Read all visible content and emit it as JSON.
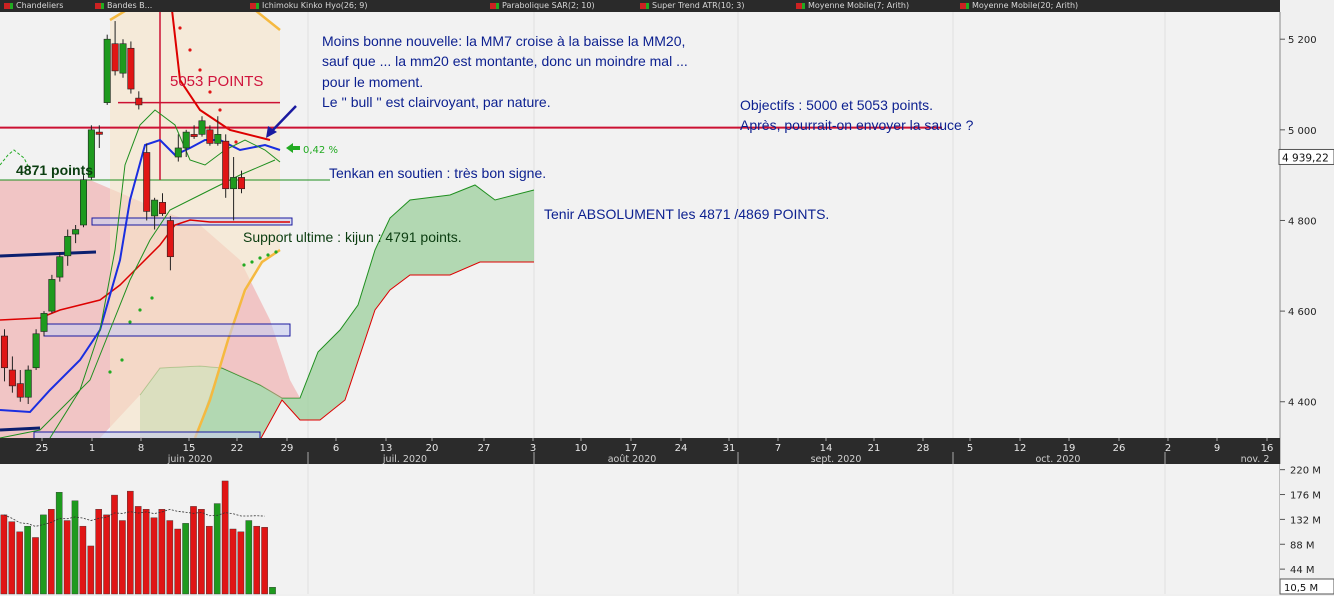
{
  "legend": [
    {
      "label": "Chandeliers"
    },
    {
      "label": "Bandes B..."
    },
    {
      "label": "Ichimoku Kinko Hyo(26; 9)"
    },
    {
      "label": "Parabolique SAR(2; 10)"
    },
    {
      "label": "Super Trend ATR(10; 3)"
    },
    {
      "label": "Moyenne Mobile(7; Arith)"
    },
    {
      "label": "Moyenne Mobile(20; Arith)"
    }
  ],
  "price_axis": {
    "ticks": [
      "5 200",
      "5 000",
      "4 800",
      "4 600",
      "4 400"
    ],
    "current": "4 939,22"
  },
  "volume_axis": {
    "ticks": [
      "220 M",
      "176 M",
      "132 M",
      "88 M",
      "44 M"
    ],
    "current": "10,5 M"
  },
  "time_axis": {
    "days": [
      "25",
      "1",
      "8",
      "15",
      "22",
      "29",
      "6",
      "13",
      "20",
      "27",
      "3",
      "10",
      "17",
      "24",
      "31",
      "7",
      "14",
      "21",
      "28",
      "5",
      "12",
      "19",
      "26",
      "2",
      "9",
      "16"
    ],
    "months": [
      "juin 2020",
      "juil. 2020",
      "août 2020",
      "sept. 2020",
      "oct. 2020",
      "nov. 2"
    ]
  },
  "annotations": {
    "main_lines": [
      "Moins bonne nouvelle: la MM7 croise à la baisse la MM20,",
      "sauf que ... la mm20 est montante, donc un moindre mal ...",
      "pour le moment.",
      "Le '' bull '' est clairvoyant, par nature."
    ],
    "objectifs": [
      "Objectifs : 5000 et 5053 points.",
      "Après, pourrait-on envoyer la sauce ?"
    ],
    "points_5053": "5053 POINTS",
    "points_4871": "4871 points",
    "tenkan": "Tenkan en soutien : très bon signe.",
    "tenir": "Tenir ABSOLUMENT les 4871  /4869 POINTS.",
    "support": "Support ultime : kijun : 4791 points.",
    "pct": "0,42 %"
  },
  "colors": {
    "up": "#1e9a1e",
    "down": "#e01515",
    "tenkan": "#1a2ee0",
    "kijun": "#dd0000",
    "bollinger": "#f5b940",
    "cloud_green": "#9ccf9c",
    "cloud_red": "#f0a0a0",
    "line_red": "#cc1133",
    "navy": "#0b1f6f"
  },
  "chart_data": [
    {
      "type": "candlestick",
      "title": "",
      "ylim": [
        4320,
        5260
      ],
      "xlabel": "",
      "ylabel": "",
      "series": [
        {
          "values": [
            {
              "date": "2020-05-19",
              "o": 4545,
              "h": 4560,
              "l": 4445,
              "c": 4475
            },
            {
              "date": "2020-05-20",
              "o": 4470,
              "h": 4500,
              "l": 4420,
              "c": 4435
            },
            {
              "date": "2020-05-21",
              "o": 4440,
              "h": 4470,
              "l": 4400,
              "c": 4410
            },
            {
              "date": "2020-05-22",
              "o": 4410,
              "h": 4480,
              "l": 4395,
              "c": 4470
            },
            {
              "date": "2020-05-25",
              "o": 4475,
              "h": 4560,
              "l": 4470,
              "c": 4550
            },
            {
              "date": "2020-05-26",
              "o": 4555,
              "h": 4600,
              "l": 4545,
              "c": 4595
            },
            {
              "date": "2020-05-27",
              "o": 4600,
              "h": 4680,
              "l": 4595,
              "c": 4670
            },
            {
              "date": "2020-05-28",
              "o": 4675,
              "h": 4730,
              "l": 4665,
              "c": 4720
            },
            {
              "date": "2020-05-29",
              "o": 4722,
              "h": 4780,
              "l": 4700,
              "c": 4765
            },
            {
              "date": "2020-06-01",
              "o": 4770,
              "h": 4790,
              "l": 4750,
              "c": 4780
            },
            {
              "date": "2020-06-02",
              "o": 4790,
              "h": 4900,
              "l": 4785,
              "c": 4890
            },
            {
              "date": "2020-06-03",
              "o": 4895,
              "h": 5010,
              "l": 4890,
              "c": 5000
            },
            {
              "date": "2020-06-04",
              "o": 4995,
              "h": 5010,
              "l": 4960,
              "c": 4990
            },
            {
              "date": "2020-06-05",
              "o": 5060,
              "h": 5210,
              "l": 5055,
              "c": 5200
            },
            {
              "date": "2020-06-08",
              "o": 5190,
              "h": 5240,
              "l": 5120,
              "c": 5130
            },
            {
              "date": "2020-06-09",
              "o": 5125,
              "h": 5200,
              "l": 5115,
              "c": 5190
            },
            {
              "date": "2020-06-10",
              "o": 5180,
              "h": 5195,
              "l": 5080,
              "c": 5090
            },
            {
              "date": "2020-06-11",
              "o": 5070,
              "h": 5085,
              "l": 5045,
              "c": 5055
            },
            {
              "date": "2020-06-12",
              "o": 4950,
              "h": 4970,
              "l": 4800,
              "c": 4820
            },
            {
              "date": "2020-06-15",
              "o": 4810,
              "h": 4850,
              "l": 4780,
              "c": 4845
            },
            {
              "date": "2020-06-16",
              "o": 4840,
              "h": 4860,
              "l": 4810,
              "c": 4815
            },
            {
              "date": "2020-06-17",
              "o": 4800,
              "h": 4810,
              "l": 4690,
              "c": 4720
            },
            {
              "date": "2020-06-18",
              "o": 4940,
              "h": 4990,
              "l": 4930,
              "c": 4960
            },
            {
              "date": "2020-06-19",
              "o": 4960,
              "h": 5000,
              "l": 4940,
              "c": 4995
            },
            {
              "date": "2020-06-22",
              "o": 4990,
              "h": 5010,
              "l": 4980,
              "c": 4985
            },
            {
              "date": "2020-06-23",
              "o": 4990,
              "h": 5030,
              "l": 4985,
              "c": 5020
            },
            {
              "date": "2020-06-24",
              "o": 5000,
              "h": 5010,
              "l": 4965,
              "c": 4970
            },
            {
              "date": "2020-06-25",
              "o": 4970,
              "h": 5030,
              "l": 4965,
              "c": 4990
            },
            {
              "date": "2020-06-26",
              "o": 4975,
              "h": 4990,
              "l": 4850,
              "c": 4870
            },
            {
              "date": "2020-06-29",
              "o": 4870,
              "h": 4940,
              "l": 4800,
              "c": 4895
            },
            {
              "date": "2020-06-30",
              "o": 4895,
              "h": 4910,
              "l": 4860,
              "c": 4870
            }
          ]
        }
      ]
    },
    {
      "type": "bar",
      "title": "",
      "ylim": [
        0,
        230
      ],
      "ylabel": "",
      "series": [
        {
          "values": [
            140,
            128,
            110,
            120,
            100,
            140,
            150,
            180,
            130,
            165,
            120,
            85,
            150,
            140,
            175,
            130,
            182,
            155,
            150,
            135,
            150,
            130,
            115,
            125,
            155,
            150,
            120,
            160,
            200,
            115,
            110,
            130,
            120,
            118,
            12
          ]
        }
      ]
    }
  ]
}
